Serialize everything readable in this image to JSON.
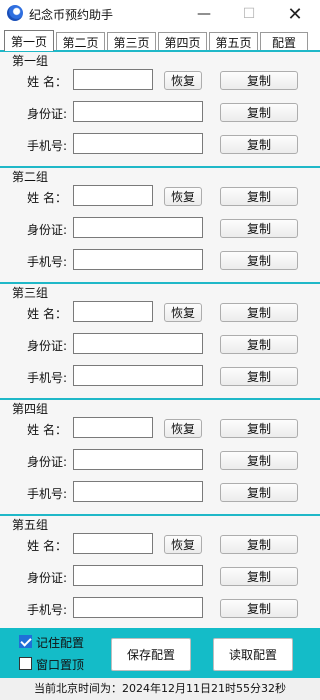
{
  "window": {
    "title": "纪念币预约助手",
    "minimize_symbol": "—",
    "maximize_symbol": "☐",
    "close_symbol": "✕"
  },
  "tabs": [
    {
      "label": "第一页",
      "active": true
    },
    {
      "label": "第二页",
      "active": false
    },
    {
      "label": "第三页",
      "active": false
    },
    {
      "label": "第四页",
      "active": false
    },
    {
      "label": "第五页",
      "active": false
    },
    {
      "label": "配置",
      "active": false
    }
  ],
  "labels": {
    "name": "姓 名：",
    "id_card": "身份证:",
    "phone": "手机号:",
    "restore": "恢复",
    "copy": "复制"
  },
  "groups": [
    {
      "title": "第一组",
      "name": "",
      "id_card": "",
      "phone": ""
    },
    {
      "title": "第二组",
      "name": "",
      "id_card": "",
      "phone": ""
    },
    {
      "title": "第三组",
      "name": "",
      "id_card": "",
      "phone": ""
    },
    {
      "title": "第四组",
      "name": "",
      "id_card": "",
      "phone": ""
    },
    {
      "title": "第五组",
      "name": "",
      "id_card": "",
      "phone": ""
    }
  ],
  "bottom": {
    "remember_label": "记住配置",
    "remember_checked": true,
    "topmost_label": "窗口置顶",
    "topmost_checked": false,
    "save_label": "保存配置",
    "load_label": "读取配置"
  },
  "status": {
    "text": "当前北京时间为：2024年12月11日21时55分32秒"
  },
  "colors": {
    "accent": "#14bcc8",
    "separator": "#1fb8c8",
    "checkbox": "#1f6fd8"
  }
}
